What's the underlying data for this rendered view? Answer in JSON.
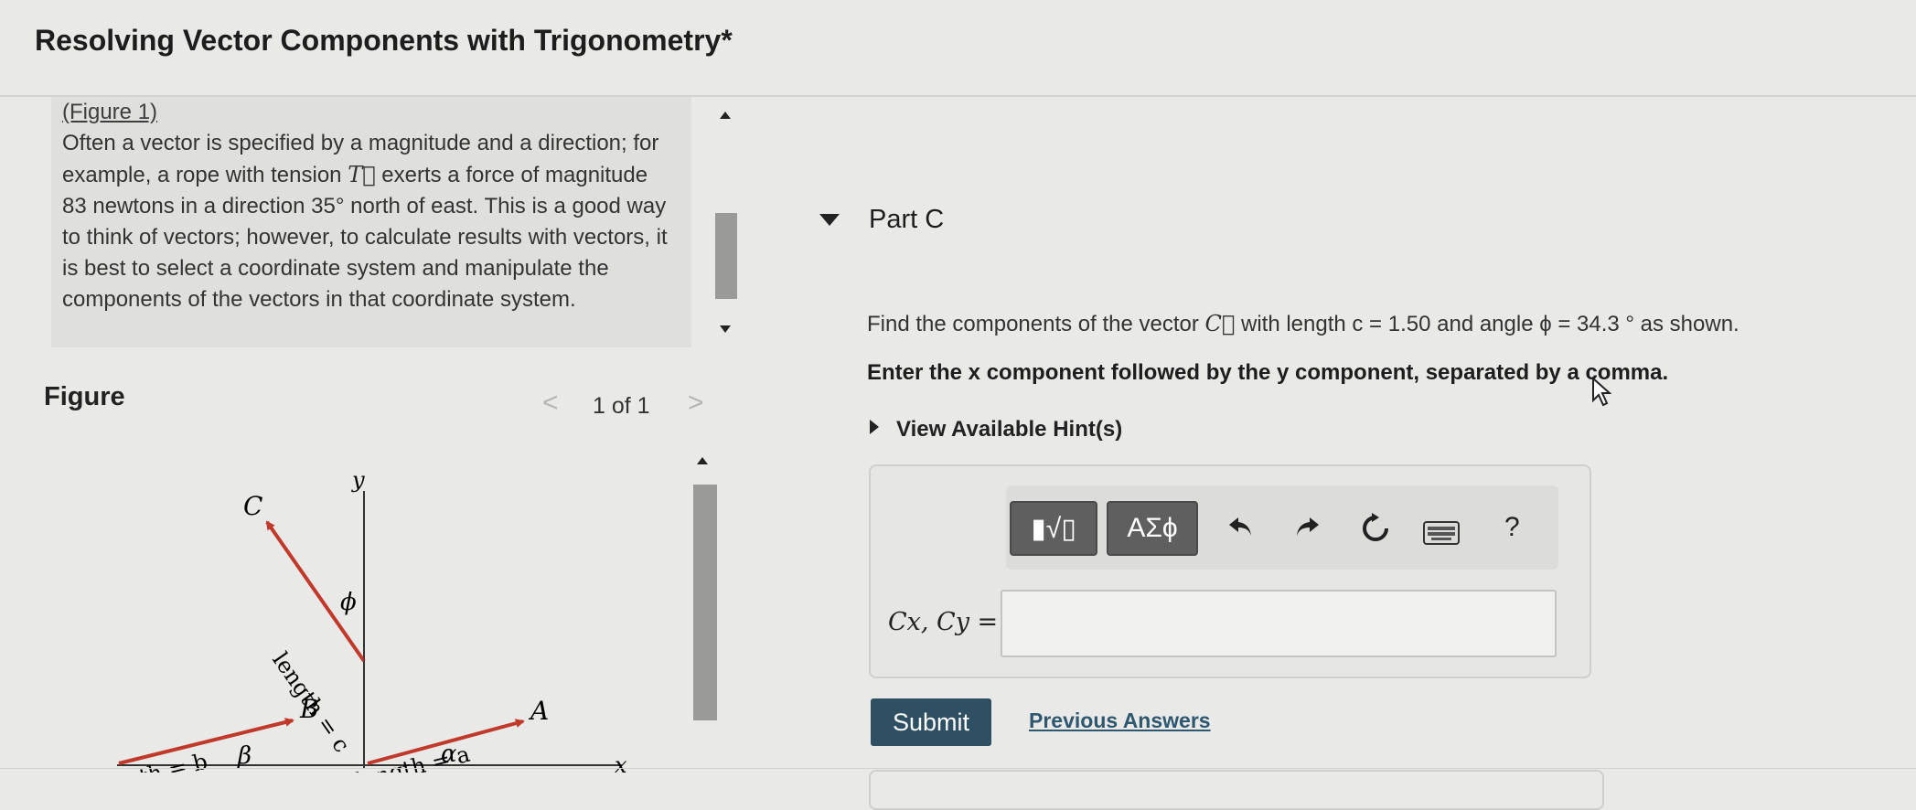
{
  "page": {
    "title": "Resolving Vector Components with Trigonometry*"
  },
  "intro": {
    "figure_link": "(Figure 1)",
    "text_before_vec": "Often a vector is specified by a magnitude and a direction; for example, a rope with tension ",
    "vec_symbol": "T",
    "text_after_vec": " exerts a force of magnitude 83 newtons in a direction 35° north of east. This is a good way to think of vectors; however, to calculate results with vectors, it is best to select a coordinate system and manipulate the components of the vectors in that coordinate system."
  },
  "figure": {
    "label": "Figure",
    "pager": "1 of 1",
    "prev_icon": "<",
    "next_icon": ">",
    "labels": {
      "y_axis": "y",
      "x_axis": "x",
      "vec_c": "C",
      "len_c": "length = c",
      "phi": "ϕ",
      "len_b": "length = b",
      "vec_b": "B",
      "beta": "β",
      "len_a": "length = a",
      "vec_a": "A",
      "alpha": "α"
    }
  },
  "part": {
    "label": "Part C",
    "question_pre": "Find the components of the vector ",
    "question_vec": "C",
    "question_mid": " with length c = 1.50 and angle ϕ = 34.3 ° as shown.",
    "instruction": "Enter the x component followed by the y component, separated by a comma.",
    "hint_link": "View Available Hint(s)"
  },
  "toolbar": {
    "templates_label": "▮√▯",
    "symbols_label": "ΑΣϕ",
    "undo_icon": "undo-icon",
    "redo_icon": "redo-icon",
    "reset_icon": "reset-icon",
    "keyboard_icon": "keyboard-icon",
    "help_label": "?"
  },
  "answer": {
    "label": "Cx, Cy =",
    "value": ""
  },
  "actions": {
    "submit": "Submit",
    "previous_answers": "Previous Answers"
  },
  "colors": {
    "vector_red": "#c0392b",
    "submit_bg": "#2f4f63",
    "link": "#2d5870"
  }
}
